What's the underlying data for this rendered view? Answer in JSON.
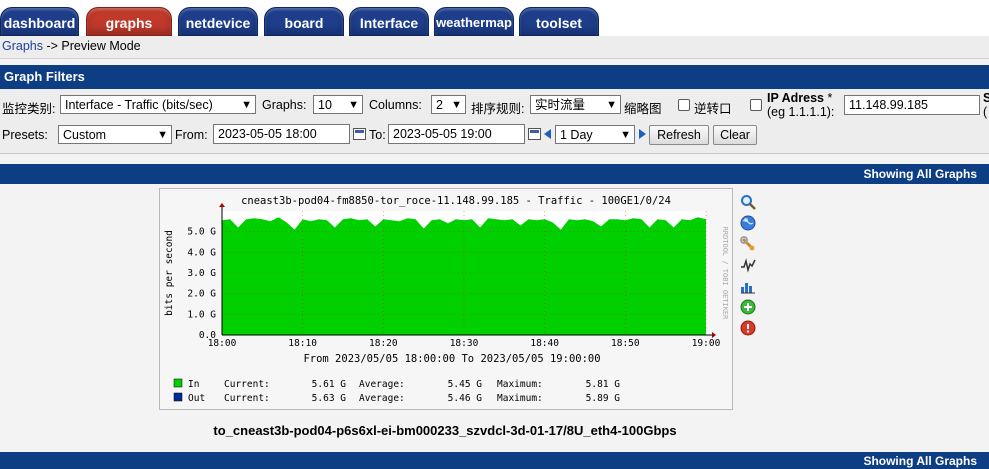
{
  "tabs": [
    {
      "label": "dashboard",
      "active": false
    },
    {
      "label": "graphs",
      "active": true
    },
    {
      "label": "netdevice",
      "active": false
    },
    {
      "label": "board",
      "active": false
    },
    {
      "label": "Interface",
      "active": false
    },
    {
      "label": "weathermap",
      "active": false
    },
    {
      "label": "toolset",
      "active": false
    }
  ],
  "breadcrumb": {
    "link": "Graphs",
    "separator": " -> ",
    "current": "Preview Mode"
  },
  "filters": {
    "header": "Graph Filters",
    "template_label": "监控类别:",
    "template_value": "Interface - Traffic (bits/sec)",
    "graphs_label": "Graphs:",
    "graphs_value": "10",
    "columns_label": "Columns:",
    "columns_value": "2",
    "sort_label": "排序规则:",
    "sort_value": "实时流量",
    "thumbnails_label": "缩略图",
    "collapse_label": "逆转口",
    "ip_label": "IP Adress",
    "ip_required": "*",
    "ip_hint": "(eg 1.1.1.1):",
    "ip_value": "11.148.99.185",
    "s_cut": "S",
    "s_cut2": "(",
    "presets_label": "Presets:",
    "presets_value": "Custom",
    "from_label": "From:",
    "from_value": "2023-05-05 18:00",
    "to_label": "To:",
    "to_value": "2023-05-05 19:00",
    "timespan_value": "1 Day",
    "refresh_label": "Refresh",
    "clear_label": "Clear"
  },
  "showing_all": "Showing All Graphs",
  "graph": {
    "title": "cneast3b-pod04-fm8850-tor_roce-11.148.99.185 - Traffic - 100GE1/0/24",
    "vertical_label": "bits per second",
    "watermark": "RRDTOOL / TOBI OETIKER",
    "period_text": "From 2023/05/05 18:00:00 To 2023/05/05 19:00:00",
    "legend": [
      {
        "key": "In",
        "color": "#00cf00",
        "current_label": "Current:",
        "current": "5.61 G",
        "average_label": "Average:",
        "average": "5.45 G",
        "maximum_label": "Maximum:",
        "maximum": "5.81 G"
      },
      {
        "key": "Out",
        "color": "#002a97",
        "current_label": "Current:",
        "current": "5.63 G",
        "average_label": "Average:",
        "average": "5.46 G",
        "maximum_label": "Maximum:",
        "maximum": "5.89 G"
      }
    ],
    "caption": "to_cneast3b-pod04-p6s6xl-ei-bm000233_szvdcl-3d-01-17/8U_eth4-100Gbps",
    "side_icons": [
      "zoom-icon",
      "globe-icon",
      "wrench-icon",
      "spikes-icon",
      "chart-icon",
      "add-icon",
      "remove-icon"
    ]
  },
  "chart_data": {
    "type": "area",
    "ylabel": "bits per second",
    "ylim": [
      0,
      6
    ],
    "y_ticks": [
      "0.0",
      "1.0 G",
      "2.0 G",
      "3.0 G",
      "4.0 G",
      "5.0 G"
    ],
    "x_ticks": [
      "18:00",
      "18:10",
      "18:20",
      "18:30",
      "18:40",
      "18:50",
      "19:00"
    ],
    "x_range_minutes": [
      0,
      60
    ],
    "series": [
      {
        "name": "In",
        "color": "#00cf00",
        "values": [
          5.55,
          5.6,
          5.2,
          5.6,
          5.65,
          5.6,
          5.5,
          5.7,
          5.45,
          5.1,
          5.6,
          5.5,
          5.6,
          5.55,
          5.2,
          5.6,
          5.65,
          5.55,
          5.6,
          5.25,
          5.6,
          5.55,
          5.5,
          5.65,
          5.6,
          5.15,
          5.55,
          5.6,
          5.4,
          5.6,
          5.55,
          5.6,
          5.2,
          5.65,
          5.6,
          5.55,
          5.6,
          5.3,
          5.6,
          5.55,
          5.6,
          5.45,
          5.1,
          5.6,
          5.55,
          5.6,
          5.5,
          5.25,
          5.6,
          5.6,
          5.55,
          5.65,
          5.6,
          5.2,
          5.6,
          5.55,
          5.2,
          5.6,
          5.55,
          5.7,
          5.6
        ]
      }
    ]
  }
}
